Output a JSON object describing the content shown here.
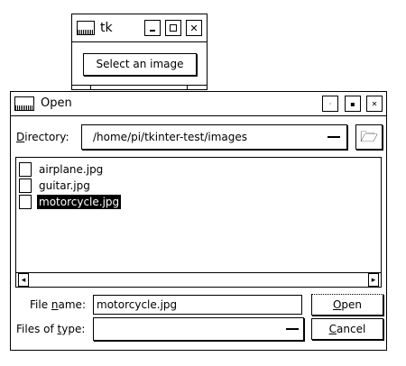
{
  "tk_window": {
    "title": "tk",
    "select_button": "Select an image"
  },
  "dialog": {
    "title": "Open",
    "directory_label_key": "D",
    "directory_label_rest": "irectory:",
    "directory_path": "/home/pi/tkinter-test/images",
    "files": [
      {
        "name": "airplane.jpg",
        "selected": false
      },
      {
        "name": "guitar.jpg",
        "selected": false
      },
      {
        "name": "motorcycle.jpg",
        "selected": true
      }
    ],
    "file_name_label_pre": "File ",
    "file_name_label_key": "n",
    "file_name_label_post": "ame:",
    "file_name_value": "motorcycle.jpg",
    "files_of_type_label_pre": "Files of ",
    "files_of_type_label_key": "t",
    "files_of_type_label_post": "ype:",
    "files_of_type_value": "",
    "open_key": "O",
    "open_rest": "pen",
    "cancel_key": "C",
    "cancel_rest": "ancel"
  }
}
